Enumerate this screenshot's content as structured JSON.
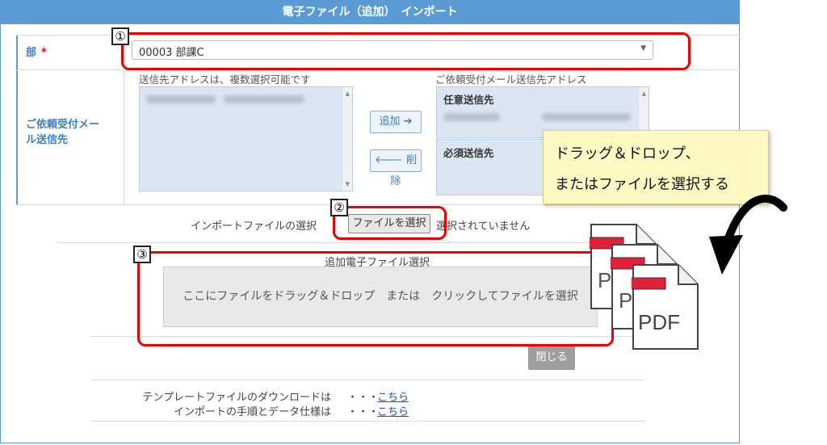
{
  "window": {
    "title": "電子ファイル（追加）　インポート"
  },
  "department": {
    "label": "部",
    "required_mark": "*",
    "selected_value": "00003 部課C"
  },
  "recipients": {
    "row_label_line1": "ご依頼受付メー",
    "row_label_line2": "ル送信先",
    "left_list_label": "送信先アドレスは、複数選択可能です",
    "right_list_label": "ご依頼受付メール送信先アドレス",
    "add_button": "追加 ➔",
    "delete_button": "🡐 削除",
    "optional_group": "任意送信先",
    "required_group": "必須送信先"
  },
  "import": {
    "label": "インポートファイルの選択",
    "choose_button": "ファイルを選択",
    "no_file_text": "選択されていません",
    "dropzone_title": "追加電子ファイル選択",
    "dropzone_text": "ここにファイルをドラッグ＆ドロップ　または　クリックしてファイルを選択",
    "close_button": "閉じる"
  },
  "footer": {
    "template_text": "テンプレートファイルのダウンロードは",
    "template_dots": "・・・",
    "template_link": "こちら",
    "spec_text": "インポートの手順とデータ仕様は",
    "spec_dots": "・・・",
    "spec_link": "こちら"
  },
  "annotations": {
    "badge1": "①",
    "badge2": "②",
    "badge3": "③",
    "callout_line1": "ドラッグ＆ドロップ、",
    "callout_line2": "またはファイルを選択する",
    "pdf_label": "PDF"
  },
  "colors": {
    "accent": "#5b9bd5",
    "highlight": "#e00000"
  }
}
